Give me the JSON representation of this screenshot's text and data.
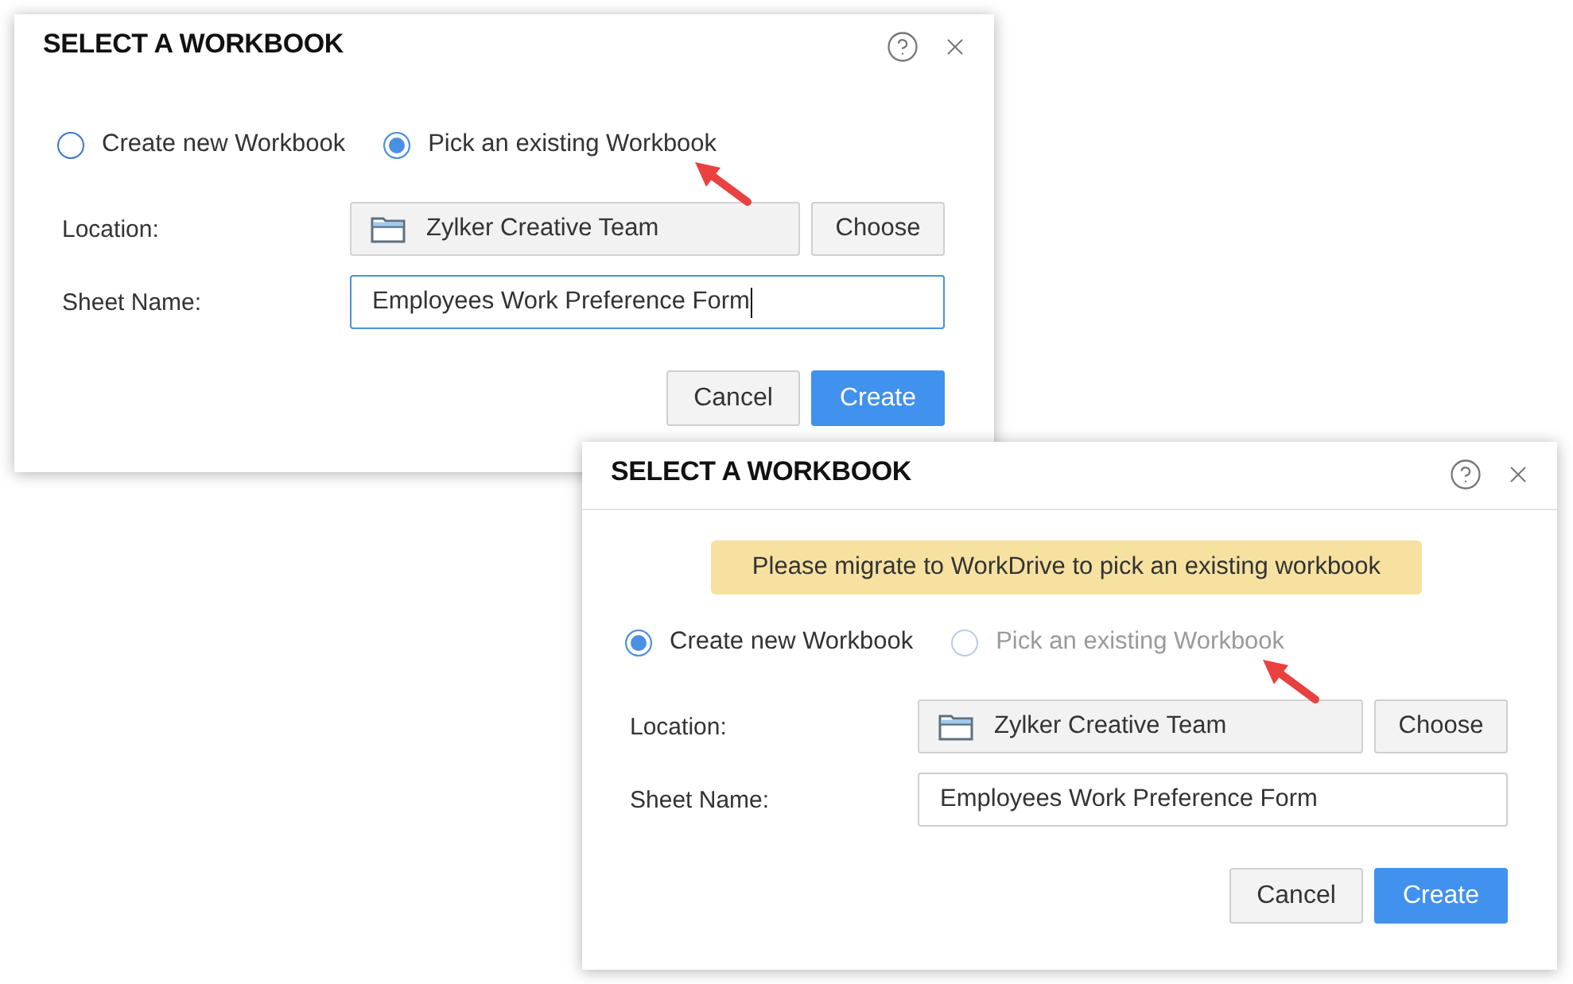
{
  "dialogs": [
    {
      "title": "SELECT A WORKBOOK",
      "header_divider": false,
      "options": [
        {
          "label": "Create new Workbook",
          "selected": false,
          "disabled": false,
          "annotated": false
        },
        {
          "label": "Pick an existing Workbook",
          "selected": true,
          "disabled": false,
          "annotated": true
        }
      ],
      "location": {
        "label": "Location:",
        "value": "Zylker Creative Team",
        "button": "Choose"
      },
      "sheet_name": {
        "label": "Sheet Name:",
        "value": "Employees Work Preference Form",
        "focused": true
      },
      "buttons": [
        {
          "label": "Cancel",
          "kind": "secondary"
        },
        {
          "label": "Create",
          "kind": "primary"
        }
      ]
    },
    {
      "title": "SELECT A WORKBOOK",
      "header_divider": true,
      "notice": "Please migrate to WorkDrive to pick an existing workbook",
      "options": [
        {
          "label": "Create new Workbook",
          "selected": true,
          "disabled": false,
          "annotated": false
        },
        {
          "label": "Pick an existing Workbook",
          "selected": false,
          "disabled": true,
          "annotated": true
        }
      ],
      "location": {
        "label": "Location:",
        "value": "Zylker Creative Team",
        "button": "Choose"
      },
      "sheet_name": {
        "label": "Sheet Name:",
        "value": "Employees Work Preference Form",
        "focused": false
      },
      "buttons": [
        {
          "label": "Cancel",
          "kind": "secondary"
        },
        {
          "label": "Create",
          "kind": "primary"
        }
      ]
    }
  ]
}
